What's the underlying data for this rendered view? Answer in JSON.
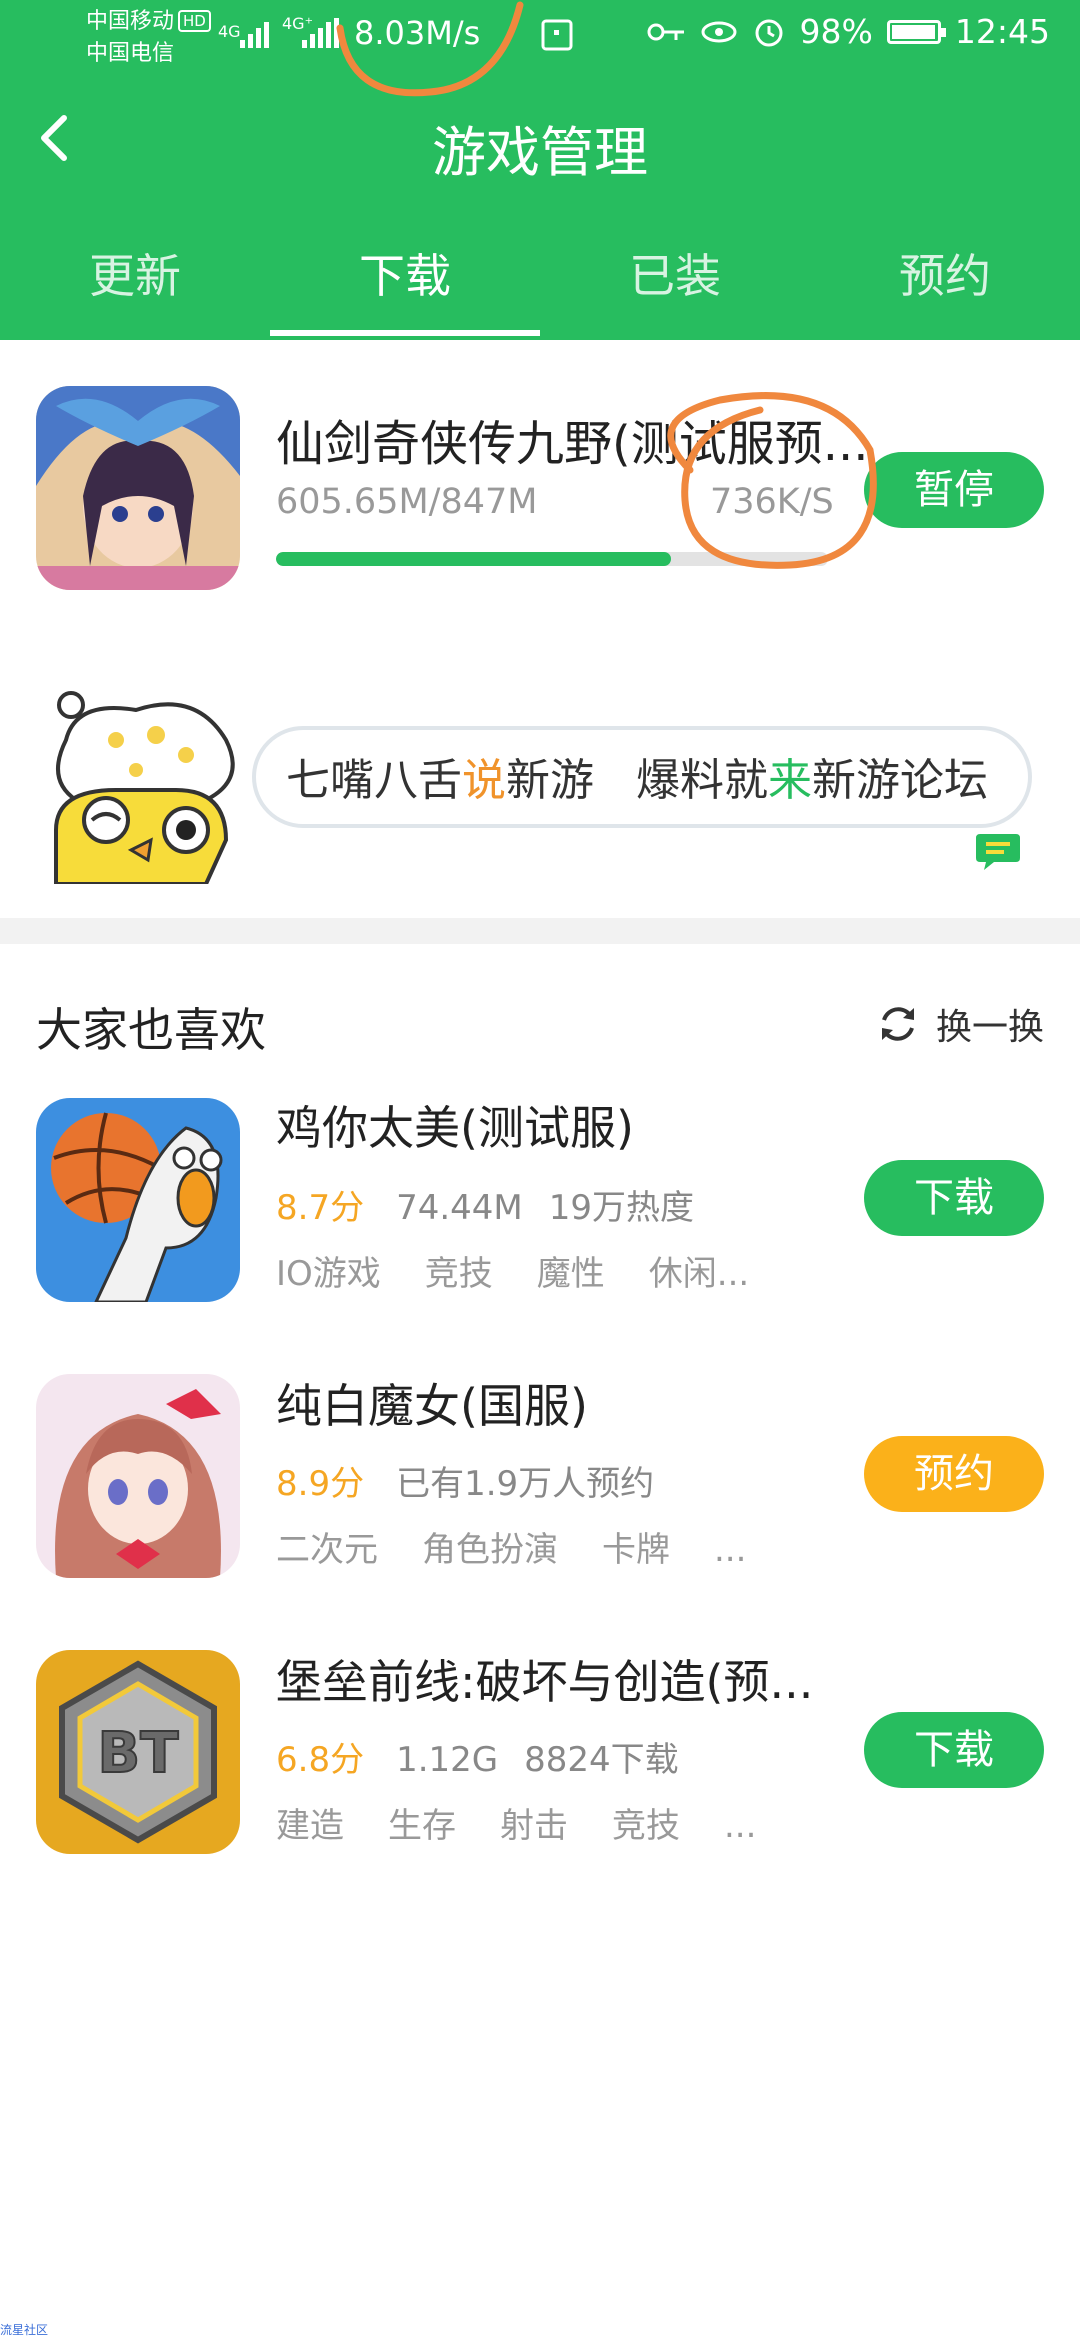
{
  "status_bar": {
    "carrier1": "中国移动",
    "carrier2": "中国电信",
    "hd": "HD",
    "sig1": "4G",
    "sig2": "4G⁺",
    "net_speed": "8.03M/s",
    "battery": "98%",
    "battery_level": 0.98,
    "time": "12:45"
  },
  "nav": {
    "title": "游戏管理",
    "tabs": [
      "更新",
      "下载",
      "已装",
      "预约"
    ],
    "active_tab": 1
  },
  "download": {
    "name": "仙剑奇侠传九野(测试服预...",
    "size": "605.65M/847M",
    "speed": "736K/S",
    "progress": 0.715,
    "button": "暂停"
  },
  "banner": {
    "part1": "七嘴八舌",
    "hl1": "说",
    "part2": "新游",
    "part3": "爆料就",
    "hl2": "来",
    "part4": "新游论坛"
  },
  "section": {
    "title": "大家也喜欢",
    "refresh": "换一换"
  },
  "recommendations": [
    {
      "name": "鸡你太美(测试服)",
      "score": "8.7分",
      "meta1": "74.44M",
      "meta2": "19万热度",
      "tags": [
        "IO游戏",
        "竞技",
        "魔性",
        "休闲..."
      ],
      "button": "下载"
    },
    {
      "name": "纯白魔女(国服)",
      "score": "8.9分",
      "meta1": "已有1.9万人预约",
      "meta2": "",
      "tags": [
        "二次元",
        "角色扮演",
        "卡牌",
        "..."
      ],
      "button": "预约"
    },
    {
      "name": "堡垒前线:破坏与创造(预...",
      "score": "6.8分",
      "meta1": "1.12G",
      "meta2": "8824下载",
      "tags": [
        "建造",
        "生存",
        "射击",
        "竞技",
        "..."
      ],
      "button": "下载"
    }
  ],
  "watermark": "流星社区",
  "colors": {
    "brand_green": "#27bd5f",
    "reserve_orange": "#fbb11a",
    "score_orange": "#f5a623",
    "annotation": "#f0883e"
  }
}
